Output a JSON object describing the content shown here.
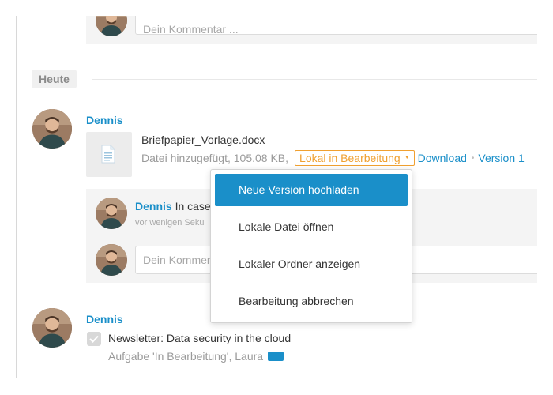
{
  "comment_input": {
    "placeholder": "Dein Kommentar ..."
  },
  "day_divider": {
    "label": "Heute"
  },
  "file_post": {
    "author": "Dennis",
    "file_name": "Briefpapier_Vorlage.docx",
    "meta": "Datei hinzugefügt, 105.08 KB,",
    "status_label": "Lokal in Bearbeitung",
    "download_label": "Download",
    "version_label": "Version 1",
    "icons": {
      "file": "document-icon",
      "status_caret": "caret-down-icon"
    }
  },
  "thread": {
    "reply_author": "Dennis",
    "reply_text": "In case",
    "reply_time": "vor wenigen Seku",
    "reply_input_placeholder": "Dein Kommentar"
  },
  "dropdown_menu": {
    "items": [
      {
        "label": "Neue Version hochladen",
        "active": true
      },
      {
        "label": "Lokale Datei öffnen",
        "active": false
      },
      {
        "label": "Lokaler Ordner anzeigen",
        "active": false
      },
      {
        "label": "Bearbeitung abbrechen",
        "active": false
      }
    ]
  },
  "task_post": {
    "author": "Dennis",
    "title": "Newsletter: Data security in the cloud",
    "meta": "Aufgabe 'In Bearbeitung', Laura",
    "checked": true
  },
  "colors": {
    "accent": "#1a8fc9",
    "status_orange": "#f0a030",
    "panel_bg": "#f4f4f4"
  }
}
